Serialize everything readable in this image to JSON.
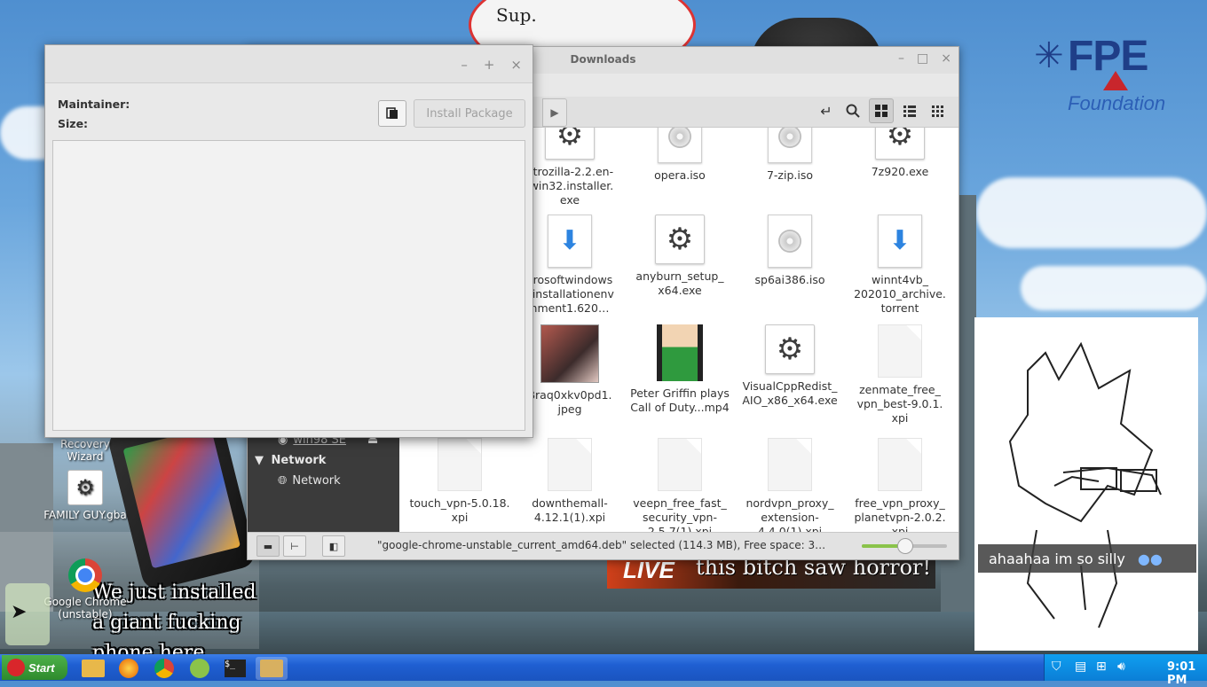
{
  "desktop": {
    "fpe_logo": {
      "main": "FPE",
      "sub": "Foundation"
    },
    "circle_art_text": "Sup.",
    "icons": [
      {
        "label": "Recovery Wizard"
      },
      {
        "label": "FAMILY GUY.gba"
      },
      {
        "label": "Google Chrome (unstable)"
      }
    ],
    "meme_caption": "We just installed a giant fucking phone here",
    "live_banner": {
      "live": "LIVE",
      "text": "this bitch saw horror!"
    },
    "drawing_caption": "ahaahaa im so silly"
  },
  "installer": {
    "labels": {
      "maintainer": "Maintainer:",
      "size": "Size:"
    },
    "install_button": "Install Package"
  },
  "files": {
    "title": "Downloads",
    "sidebar": {
      "device_item": "win98 SE",
      "network_header": "Network",
      "network_item": "Network"
    },
    "items": [
      {
        "name": "etrozilla-2.2.en-\n.win32.installer.\nexe",
        "icon": "gear-icon"
      },
      {
        "name": "opera.iso",
        "icon": "disc-icon"
      },
      {
        "name": "7-zip.iso",
        "icon": "disc-icon"
      },
      {
        "name": "7z920.exe",
        "icon": "gear-icon"
      },
      {
        "name": "crosoftwindows\neinstallationenv\nnment1.620…",
        "icon": "download-icon"
      },
      {
        "name": "anyburn_setup_\nx64.exe",
        "icon": "gear-icon"
      },
      {
        "name": "sp6ai386.iso",
        "icon": "disc-icon"
      },
      {
        "name": "winnt4vb_\n202010_archive.\ntorrent",
        "icon": "download-icon"
      },
      {
        "name": "Braq0xkv0pd1.\njpeg",
        "icon": "image-icon"
      },
      {
        "name": "Peter Griffin plays\nCall of Duty...mp4",
        "icon": "video-icon"
      },
      {
        "name": "VisualCppRedist_\nAIO_x86_x64.exe",
        "icon": "gear-icon"
      },
      {
        "name": "zenmate_free_\nvpn_best-9.0.1.\nxpi",
        "icon": "document-icon"
      },
      {
        "name": "touch_vpn-5.0.18.\nxpi",
        "icon": "document-icon"
      },
      {
        "name": "downthemall-\n4.12.1(1).xpi",
        "icon": "document-icon"
      },
      {
        "name": "veepn_free_fast_\nsecurity_vpn-\n2.5.7(1).xpi",
        "icon": "document-icon"
      },
      {
        "name": "nordvpn_proxy_\nextension-\n4.4.0(1).xpi",
        "icon": "document-icon"
      },
      {
        "name": "free_vpn_proxy_\nplanetvpn-2.0.2.\nxpi",
        "icon": "document-icon"
      }
    ],
    "status_text": "\"google-chrome-unstable_current_amd64.deb\" selected (114.3 MB), Free space: 3…",
    "zoom_level": 0.5
  },
  "taskbar": {
    "start_label": "Start",
    "clock": "9:01 PM"
  }
}
